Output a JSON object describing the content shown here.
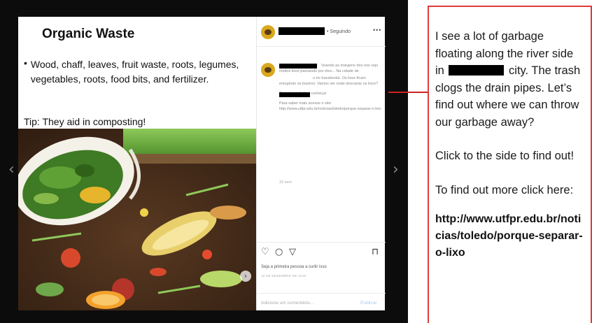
{
  "slide": {
    "title": "Organic Waste",
    "bullet": "Wood, chaff, leaves, fruit waste, roots, legumes, vegetables, roots, food bits, and fertilizer.",
    "tip": "Tip: They aid in composting!"
  },
  "instagram": {
    "following": "• Seguindo",
    "more": "•••",
    "caption_lines": [
      "Voando as margens dos nos vejo muitos lixos passando por eles... Na cidade de",
      "o rio transborda. Os lixos ficam entupindo os bueiros. Vamos ver onde descartar os lixos?",
      "Arrasta pro lado e conheça!",
      "Para saber mais acesse o site: http://www.utfpr.edu.br/noticias/toledo/porque-separar-o-lixo"
    ],
    "time_ago": "33 sem",
    "likes_text": "Seja a primeira pessoa a curtir isso",
    "date": "16 DE DEZEMBRO DE 2019",
    "comment_placeholder": "Adicione um comentário...",
    "publish_label": "Publicar"
  },
  "navigation": {
    "prev_arrow": "‹",
    "next_arrow": "›",
    "photo_next": "›"
  },
  "note": {
    "text_before_redaction": "I see a lot of garbage floating along the river side in",
    "text_after_redaction": "city. The trash clogs the drain pipes. Let’s find out where we can throw our garbage away?",
    "click_side": "Click to the side to find out!",
    "find_more": "To find out more click here:",
    "url": "http://www.utfpr.edu.br/noticias/toledo/porque-separar-o-lixo"
  },
  "colors": {
    "frame": "#0c0c0c",
    "note_border": "#e03a3a",
    "connector": "#cc2222",
    "publish": "#a7c8ee"
  }
}
